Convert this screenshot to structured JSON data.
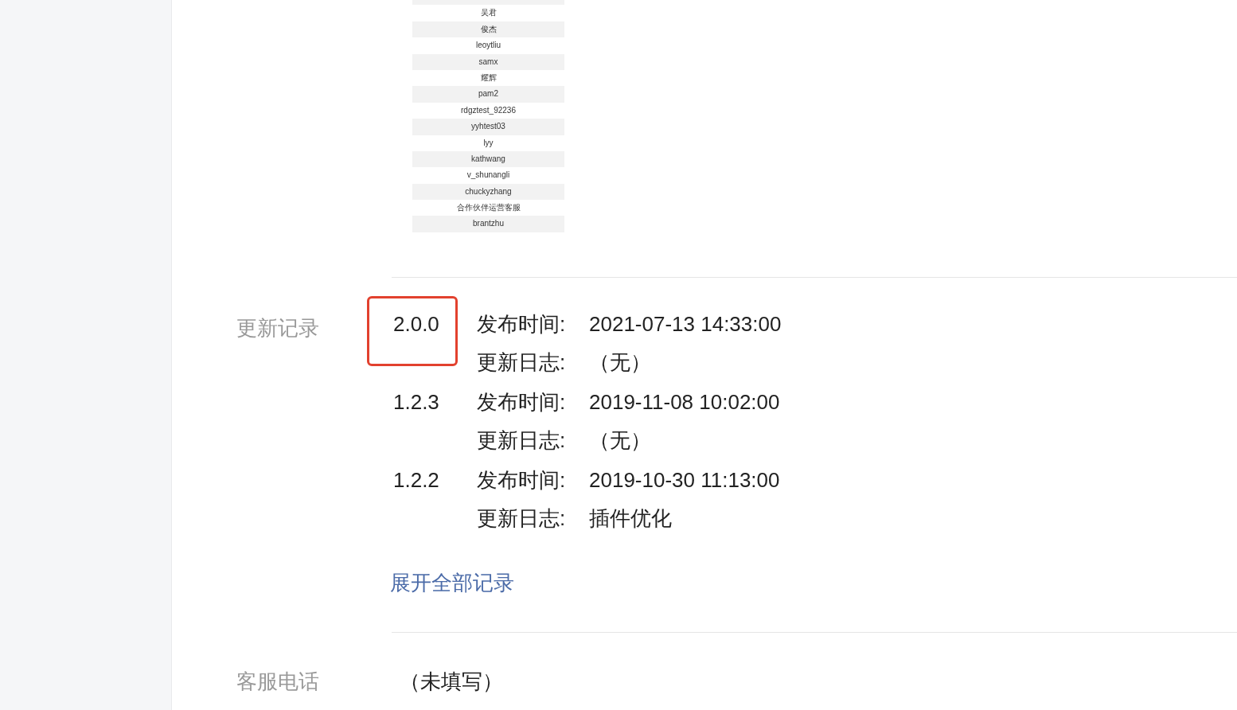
{
  "member_list": [
    "吴君",
    "俊杰",
    "leoytliu",
    "samx",
    "耀辉",
    "pam2",
    "rdgztest_92236",
    "yyhtest03",
    "lyy",
    "kathwang",
    "v_shunangli",
    "chuckyzhang",
    "合作伙伴运营客服",
    "brantzhu"
  ],
  "update_records": {
    "label": "更新记录",
    "versions": [
      {
        "version": "2.0.0",
        "highlighted": true,
        "time_label": "发布时间:",
        "time": "2021-07-13 14:33:00",
        "log_label": "更新日志:",
        "log": "（无）"
      },
      {
        "version": "1.2.3",
        "highlighted": false,
        "time_label": "发布时间:",
        "time": "2019-11-08 10:02:00",
        "log_label": "更新日志:",
        "log": "（无）"
      },
      {
        "version": "1.2.2",
        "highlighted": false,
        "time_label": "发布时间:",
        "time": "2019-10-30 11:13:00",
        "log_label": "更新日志:",
        "log": "插件优化"
      }
    ],
    "expand_link": "展开全部记录"
  },
  "service_phone": {
    "label": "客服电话",
    "value": "（未填写）"
  }
}
